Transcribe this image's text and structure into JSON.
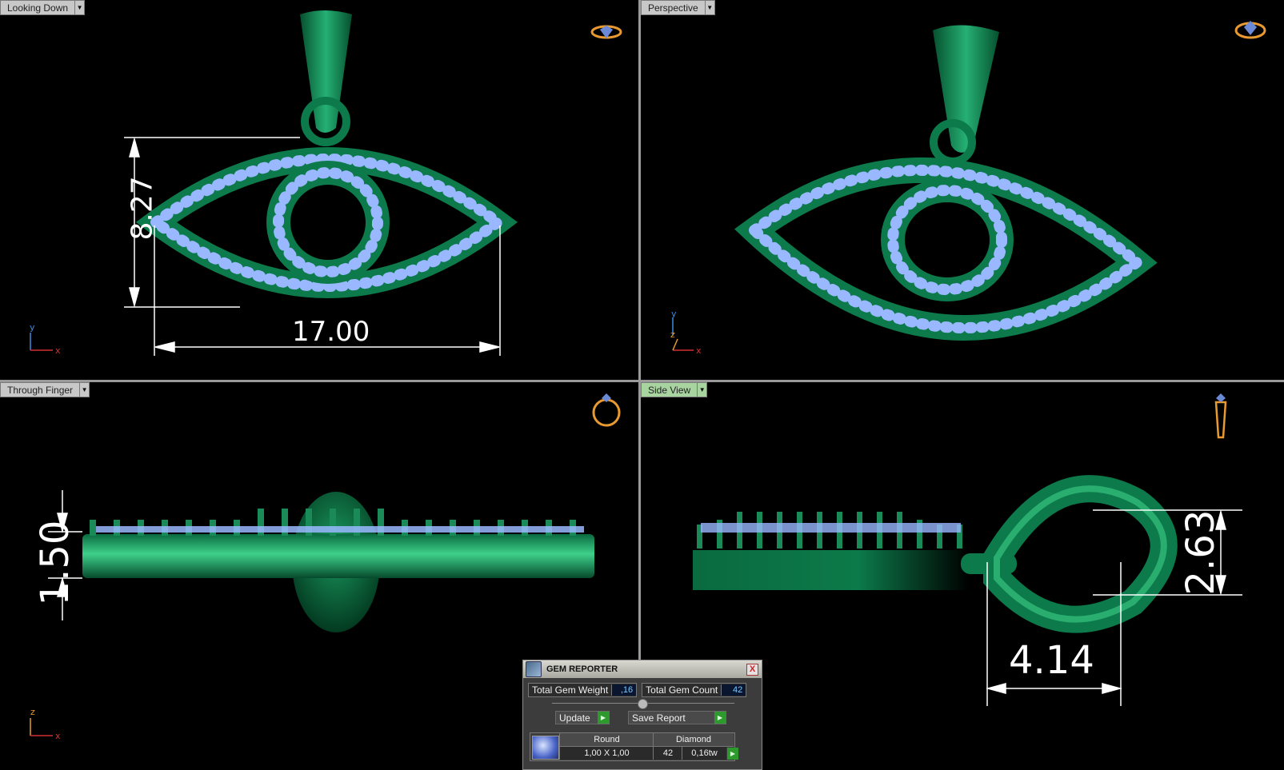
{
  "viewports": {
    "top_left": {
      "label": "Looking Down"
    },
    "top_right": {
      "label": "Perspective"
    },
    "bottom_left": {
      "label": "Through Finger"
    },
    "bottom_right": {
      "label": "Side View"
    }
  },
  "dimensions": {
    "height": "8.27",
    "width": "17.00",
    "thickness": "1.50",
    "bail_height": "2.63",
    "bail_width": "4.14"
  },
  "axes": {
    "top_left": {
      "vertical": "y",
      "horizontal": "x"
    },
    "top_right": {
      "vertical": "y",
      "horizontal": "x",
      "depth": "z"
    },
    "bottom_left": {
      "vertical": "z",
      "horizontal": "x"
    }
  },
  "gem_reporter": {
    "title": "GEM REPORTER",
    "close": "X",
    "total_weight_label": "Total Gem Weight",
    "total_weight_value": ",16",
    "total_count_label": "Total Gem Count",
    "total_count_value": "42",
    "update_label": "Update",
    "save_label": "Save Report",
    "table": {
      "shape_header": "Round",
      "material_header": "Diamond",
      "size": "1,00 X 1,00",
      "count": "42",
      "weight": "0,16tw"
    }
  },
  "colors": {
    "metal": "#0c7a4a",
    "gem": "#9ab8ff",
    "background": "#000000",
    "dimension": "#ffffff",
    "label_bg": "#c8c8c8",
    "label_active": "#a8d4a0"
  }
}
